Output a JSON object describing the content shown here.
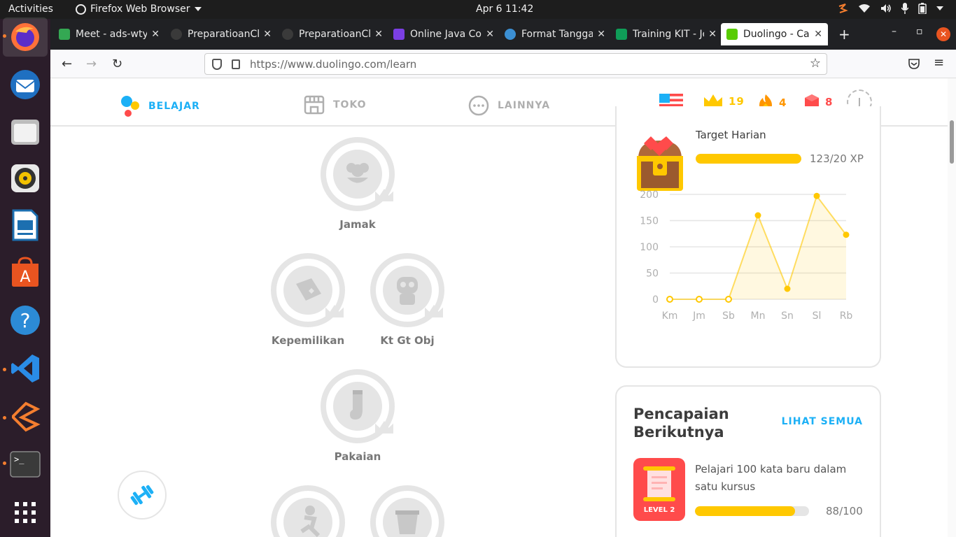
{
  "topbar": {
    "activities": "Activities",
    "app_name": "Firefox Web Browser",
    "clock": "Apr 6  11:42"
  },
  "dock": {
    "items": [
      "firefox-icon",
      "thunderbird-icon",
      "files-icon",
      "rhythmbox-icon",
      "writer-icon",
      "software-icon",
      "help-icon",
      "vscode-icon",
      "sublime-merge-icon",
      "terminal-icon",
      "apps-grid-icon"
    ]
  },
  "tabs": [
    {
      "label": "Meet - ads-wtyo",
      "color": "#34a853"
    },
    {
      "label": "PreparatioanCl",
      "color": "#555555"
    },
    {
      "label": "PreparatioanCl",
      "color": "#555555"
    },
    {
      "label": "Online Java Cor",
      "color": "#7b3fe4"
    },
    {
      "label": "Format Tanggal",
      "color": "#3b8fd3"
    },
    {
      "label": "Training KIT - Jo",
      "color": "#0f9d58"
    },
    {
      "label": "Duolingo - Cara",
      "color": "#58cc02"
    }
  ],
  "url": {
    "host": "https://www.duolingo.com",
    "path": "/learn"
  },
  "header": {
    "nav": [
      {
        "label": "BELAJAR"
      },
      {
        "label": "TOKO"
      },
      {
        "label": "LAINNYA"
      }
    ],
    "crowns": "19",
    "streak": "4",
    "gems": "8",
    "avatar": "J"
  },
  "skills": [
    {
      "name": "Jamak"
    },
    {
      "name": "Kepemilikan"
    },
    {
      "name": "Kt Gt Obj"
    },
    {
      "name": "Pakaian"
    }
  ],
  "daily_goal": {
    "title": "Target Harian",
    "xp_text": "123/20 XP",
    "progress": 1.0
  },
  "chart_data": {
    "type": "area",
    "categories": [
      "Km",
      "Jm",
      "Sb",
      "Mn",
      "Sn",
      "Sl",
      "Rb"
    ],
    "values": [
      0,
      0,
      0,
      160,
      20,
      197,
      123
    ],
    "ylim": [
      0,
      200
    ],
    "yticks": [
      "0",
      "50",
      "100",
      "150",
      "200"
    ],
    "color": "#ffc800",
    "grid": true
  },
  "achievement": {
    "title": "Pencapaian Berikutnya",
    "link": "LIHAT SEMUA",
    "badge_level": "LEVEL 2",
    "description": "Pelajari 100 kata baru dalam satu kursus",
    "count_text": "88/100",
    "progress": 0.88
  },
  "colors": {
    "accent_blue": "#1cb0f6",
    "gold": "#ffc800",
    "streak_orange": "#ff9600",
    "gem_red": "#ff4b4b",
    "locked_gray": "#e5e5e5"
  }
}
